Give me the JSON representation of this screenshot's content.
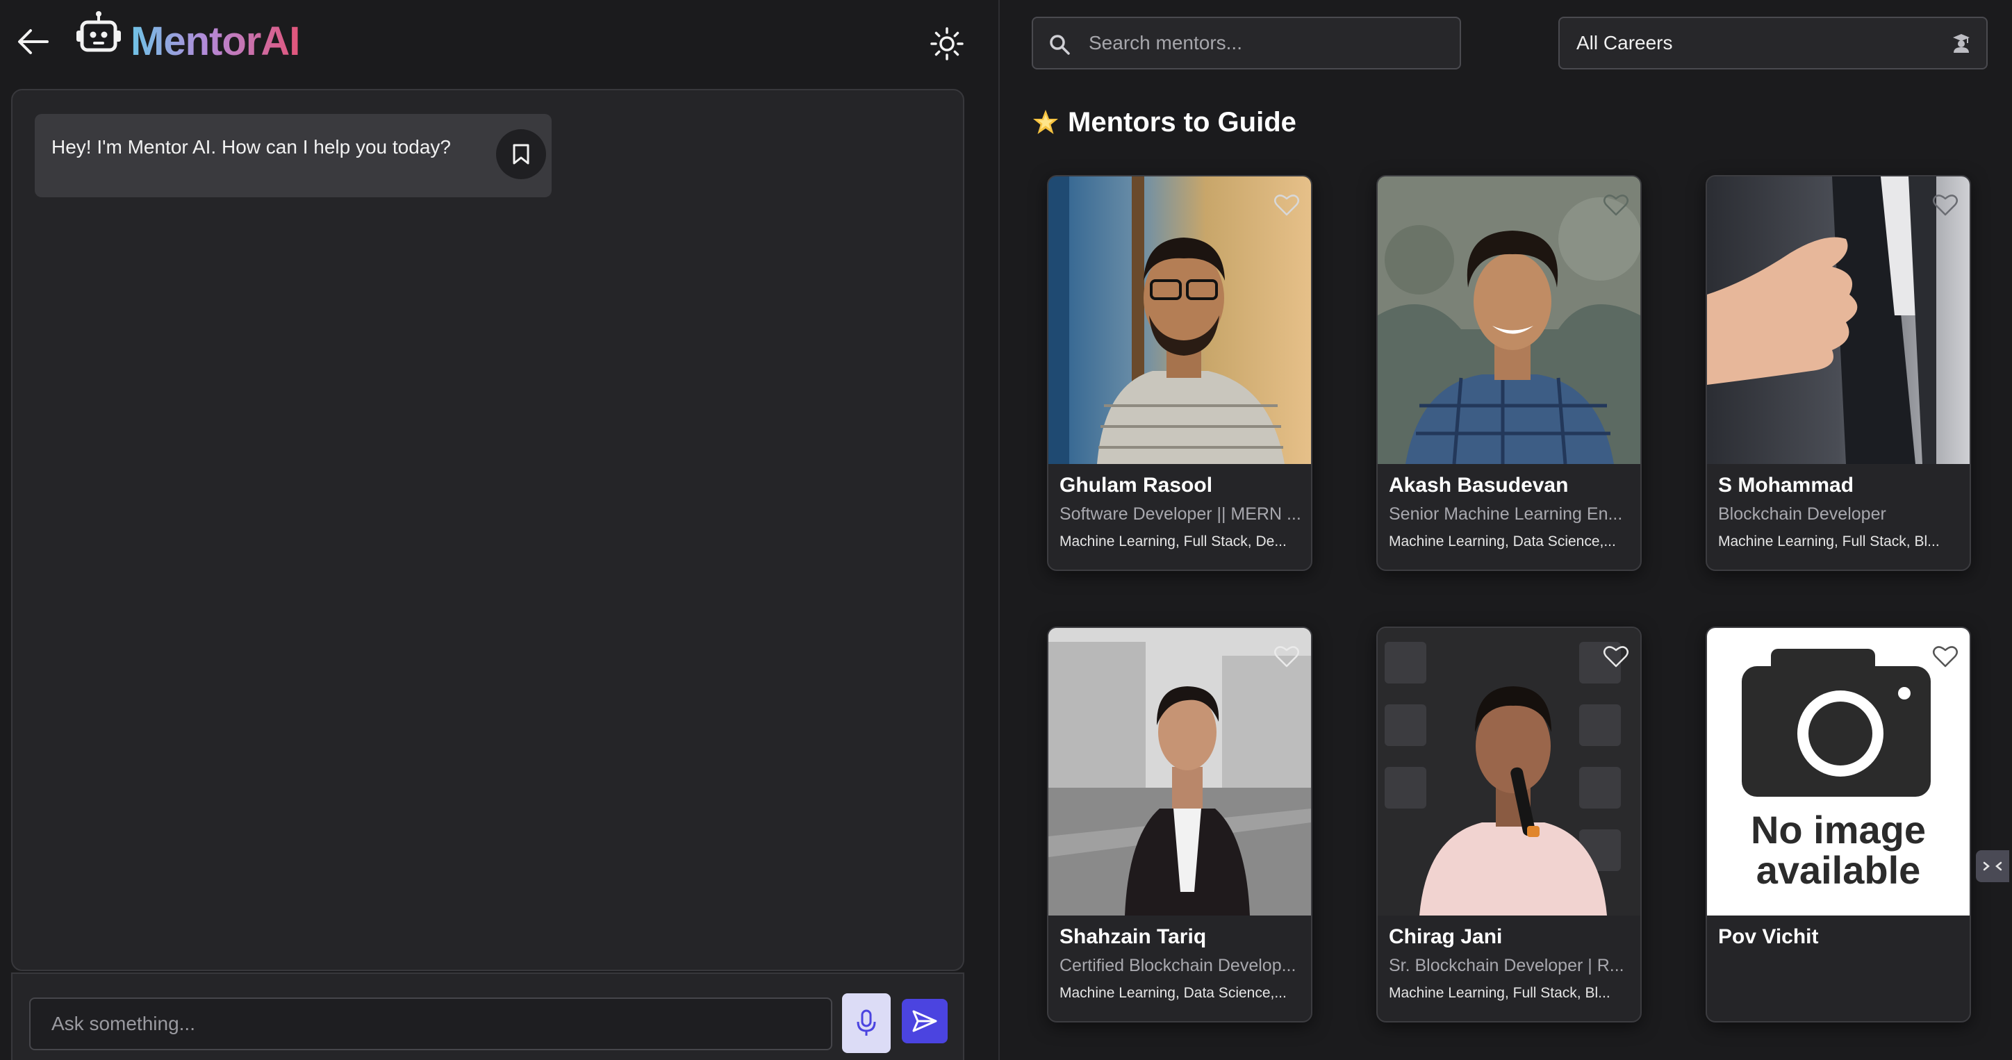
{
  "app": {
    "title": "MentorAI",
    "logo_icon": "robot-icon",
    "back_icon": "arrow-left-icon",
    "theme_icon": "sun-icon"
  },
  "chat": {
    "messages": [
      {
        "role": "bot",
        "text": "Hey! I'm Mentor AI. How can I help you today?",
        "action_icon": "bookmark-icon"
      }
    ],
    "input_placeholder": "Ask something...",
    "mic_icon": "microphone-icon",
    "send_icon": "send-icon"
  },
  "filters": {
    "search_placeholder": "Search mentors...",
    "search_icon": "search-icon",
    "career_selected": "All Careers",
    "career_icon": "graduate-icon"
  },
  "section": {
    "title": "Mentors to Guide",
    "icon": "star-icon"
  },
  "mentors": [
    {
      "name": "Ghulam Rasool",
      "role": "Software Developer || MERN ...",
      "tags": "Machine Learning, Full Stack, De...",
      "image": "portrait-photo",
      "favorite_icon": "heart-icon"
    },
    {
      "name": "Akash Basudevan",
      "role": "Senior Machine Learning En...",
      "tags": "Machine Learning, Data Science,...",
      "image": "portrait-photo",
      "favorite_icon": "heart-icon"
    },
    {
      "name": "S Mohammad",
      "role": "Blockchain Developer",
      "tags": "Machine Learning, Full Stack, Bl...",
      "image": "handshake-photo",
      "favorite_icon": "heart-icon"
    },
    {
      "name": "Shahzain Tariq",
      "role": "Certified Blockchain Develop...",
      "tags": "Machine Learning, Data Science,...",
      "image": "portrait-photo",
      "favorite_icon": "heart-icon"
    },
    {
      "name": "Chirag Jani",
      "role": "Sr. Blockchain Developer | R...",
      "tags": "Machine Learning, Full Stack, Bl...",
      "image": "speaker-photo",
      "favorite_icon": "heart-icon"
    },
    {
      "name": "Pov Vichit",
      "role": "",
      "tags": "",
      "image": "no-image-placeholder",
      "placeholder_text": [
        "No image",
        "available"
      ],
      "favorite_icon": "heart-icon"
    }
  ],
  "colors": {
    "background": "#1b1b1d",
    "panel": "#252528",
    "send_button": "#4b44e0",
    "mic_button": "#dcdcf6",
    "logo_gradient": [
      "#6fc3e6",
      "#b48ad8",
      "#e2557a"
    ]
  }
}
